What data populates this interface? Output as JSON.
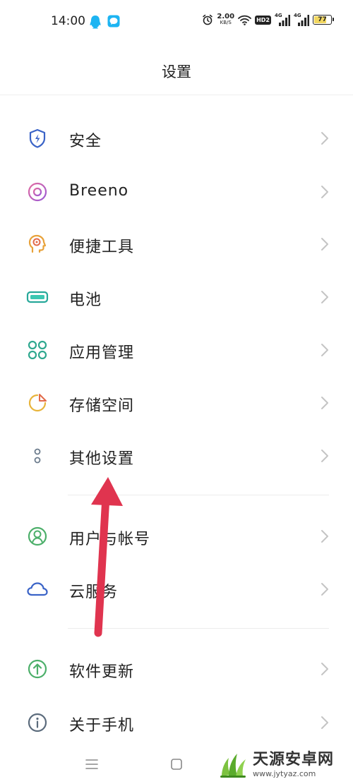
{
  "status_bar": {
    "time": "14:00",
    "net_speed_value": "2.00",
    "net_speed_unit": "KB/S",
    "hd_label": "HD2",
    "signal_1_label": "4G",
    "signal_2_label": "4G",
    "battery_level": "77",
    "battery_fraction": 0.77,
    "icons": [
      "qq-icon",
      "messenger-icon",
      "alarm-icon",
      "wifi-icon",
      "signal-icon",
      "signal-icon",
      "battery-icon"
    ]
  },
  "header": {
    "title": "设置"
  },
  "settings": [
    {
      "label": "安全",
      "icon": "security-shield-icon",
      "color": "#3a63c7"
    },
    {
      "label": "Breeno",
      "icon": "breeno-icon",
      "color": "#d65aa8"
    },
    {
      "label": "便捷工具",
      "icon": "convenience-tools-icon",
      "color": "#e8a23a"
    },
    {
      "label": "电池",
      "icon": "battery-icon",
      "color": "#27a89a"
    },
    {
      "label": "应用管理",
      "icon": "app-management-icon",
      "color": "#2fa88f"
    },
    {
      "label": "存储空间",
      "icon": "storage-icon",
      "color": "#e8b43a"
    },
    {
      "label": "其他设置",
      "icon": "other-settings-icon",
      "color": "#6b7b8c"
    },
    {
      "label": "用户与帐号",
      "icon": "user-account-icon",
      "color": "#4caf6a"
    },
    {
      "label": "云服务",
      "icon": "cloud-icon",
      "color": "#3a63c7"
    },
    {
      "label": "软件更新",
      "icon": "software-update-icon",
      "color": "#4caf6a"
    },
    {
      "label": "关于手机",
      "icon": "about-phone-icon",
      "color": "#5b6b7c"
    }
  ],
  "watermark": {
    "name": "天源安卓网",
    "url": "www.jytyaz.com"
  },
  "colors": {
    "annotation_arrow": "#e0344f",
    "chevron": "#c4c4c4",
    "divider": "#ececec"
  }
}
